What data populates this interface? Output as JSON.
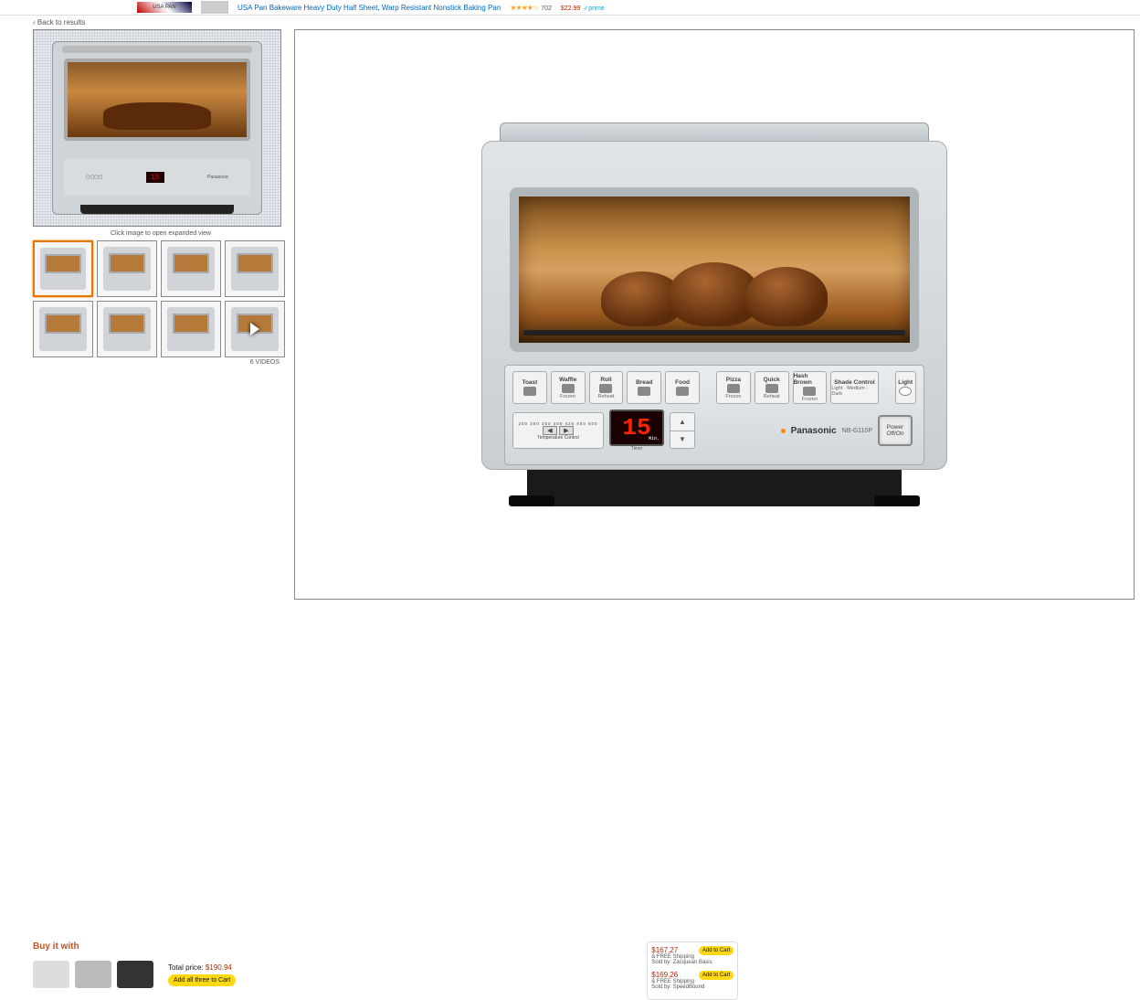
{
  "banner": {
    "logo_text": "USA PAN",
    "link_text": "USA Pan Bakeware Heavy Duty Half Sheet, Warp Resistant Nonstick Baking Pan",
    "stars": "★★★★☆",
    "review_count": "702",
    "price": "$22.99",
    "prime": "✓prime"
  },
  "back": {
    "prefix": "‹",
    "label": "Back to results"
  },
  "gallery": {
    "caption": "Click image to open expanded view",
    "video_label": "6 VIDEOS",
    "thumbs": [
      {
        "name": "front-view",
        "selected": true
      },
      {
        "name": "features-text"
      },
      {
        "name": "cooking-food"
      },
      {
        "name": "control-panel-closeup"
      },
      {
        "name": "with-tray"
      },
      {
        "name": "front-closed"
      },
      {
        "name": "door-open"
      },
      {
        "name": "video",
        "is_video": true
      }
    ]
  },
  "oven": {
    "timer_display": "15",
    "timer_unit": "Min.",
    "timer_label": "Timer",
    "brand": "Panasonic",
    "model": "NB-G110P",
    "power_label": "Power Off/On",
    "temp_label": "Temperature Control",
    "temp_ticks": "250 300 350 400 425 450 500",
    "modes": [
      {
        "top": "Toast",
        "bottom": ""
      },
      {
        "top": "Waffle",
        "bottom": "Frozen"
      },
      {
        "top": "Roll",
        "bottom": "Reheat"
      },
      {
        "top": "Bread",
        "bottom": ""
      },
      {
        "top": "Food",
        "bottom": ""
      },
      {
        "top": "Pizza",
        "bottom": "Frozen"
      },
      {
        "top": "Quick",
        "bottom": "Reheat"
      },
      {
        "top": "Hash Brown",
        "bottom": "Frozen"
      }
    ],
    "shade": {
      "title": "Shade Control",
      "sub": "Light · Medium · Dark"
    },
    "light": {
      "label": "Light"
    }
  },
  "buy_it": {
    "heading": "Buy it with",
    "total_label": "Total price:",
    "total_price": "$190.94",
    "add_all": "Add all three to Cart"
  },
  "sellers": [
    {
      "price": "$167.27",
      "ship": "& FREE Shipping",
      "by": "Sold by: Zacquean Basis",
      "btn": "Add to Cart"
    },
    {
      "price": "$169.26",
      "ship": "& FREE Shipping",
      "by": "Sold by: SpeedBound",
      "btn": "Add to Cart"
    }
  ]
}
